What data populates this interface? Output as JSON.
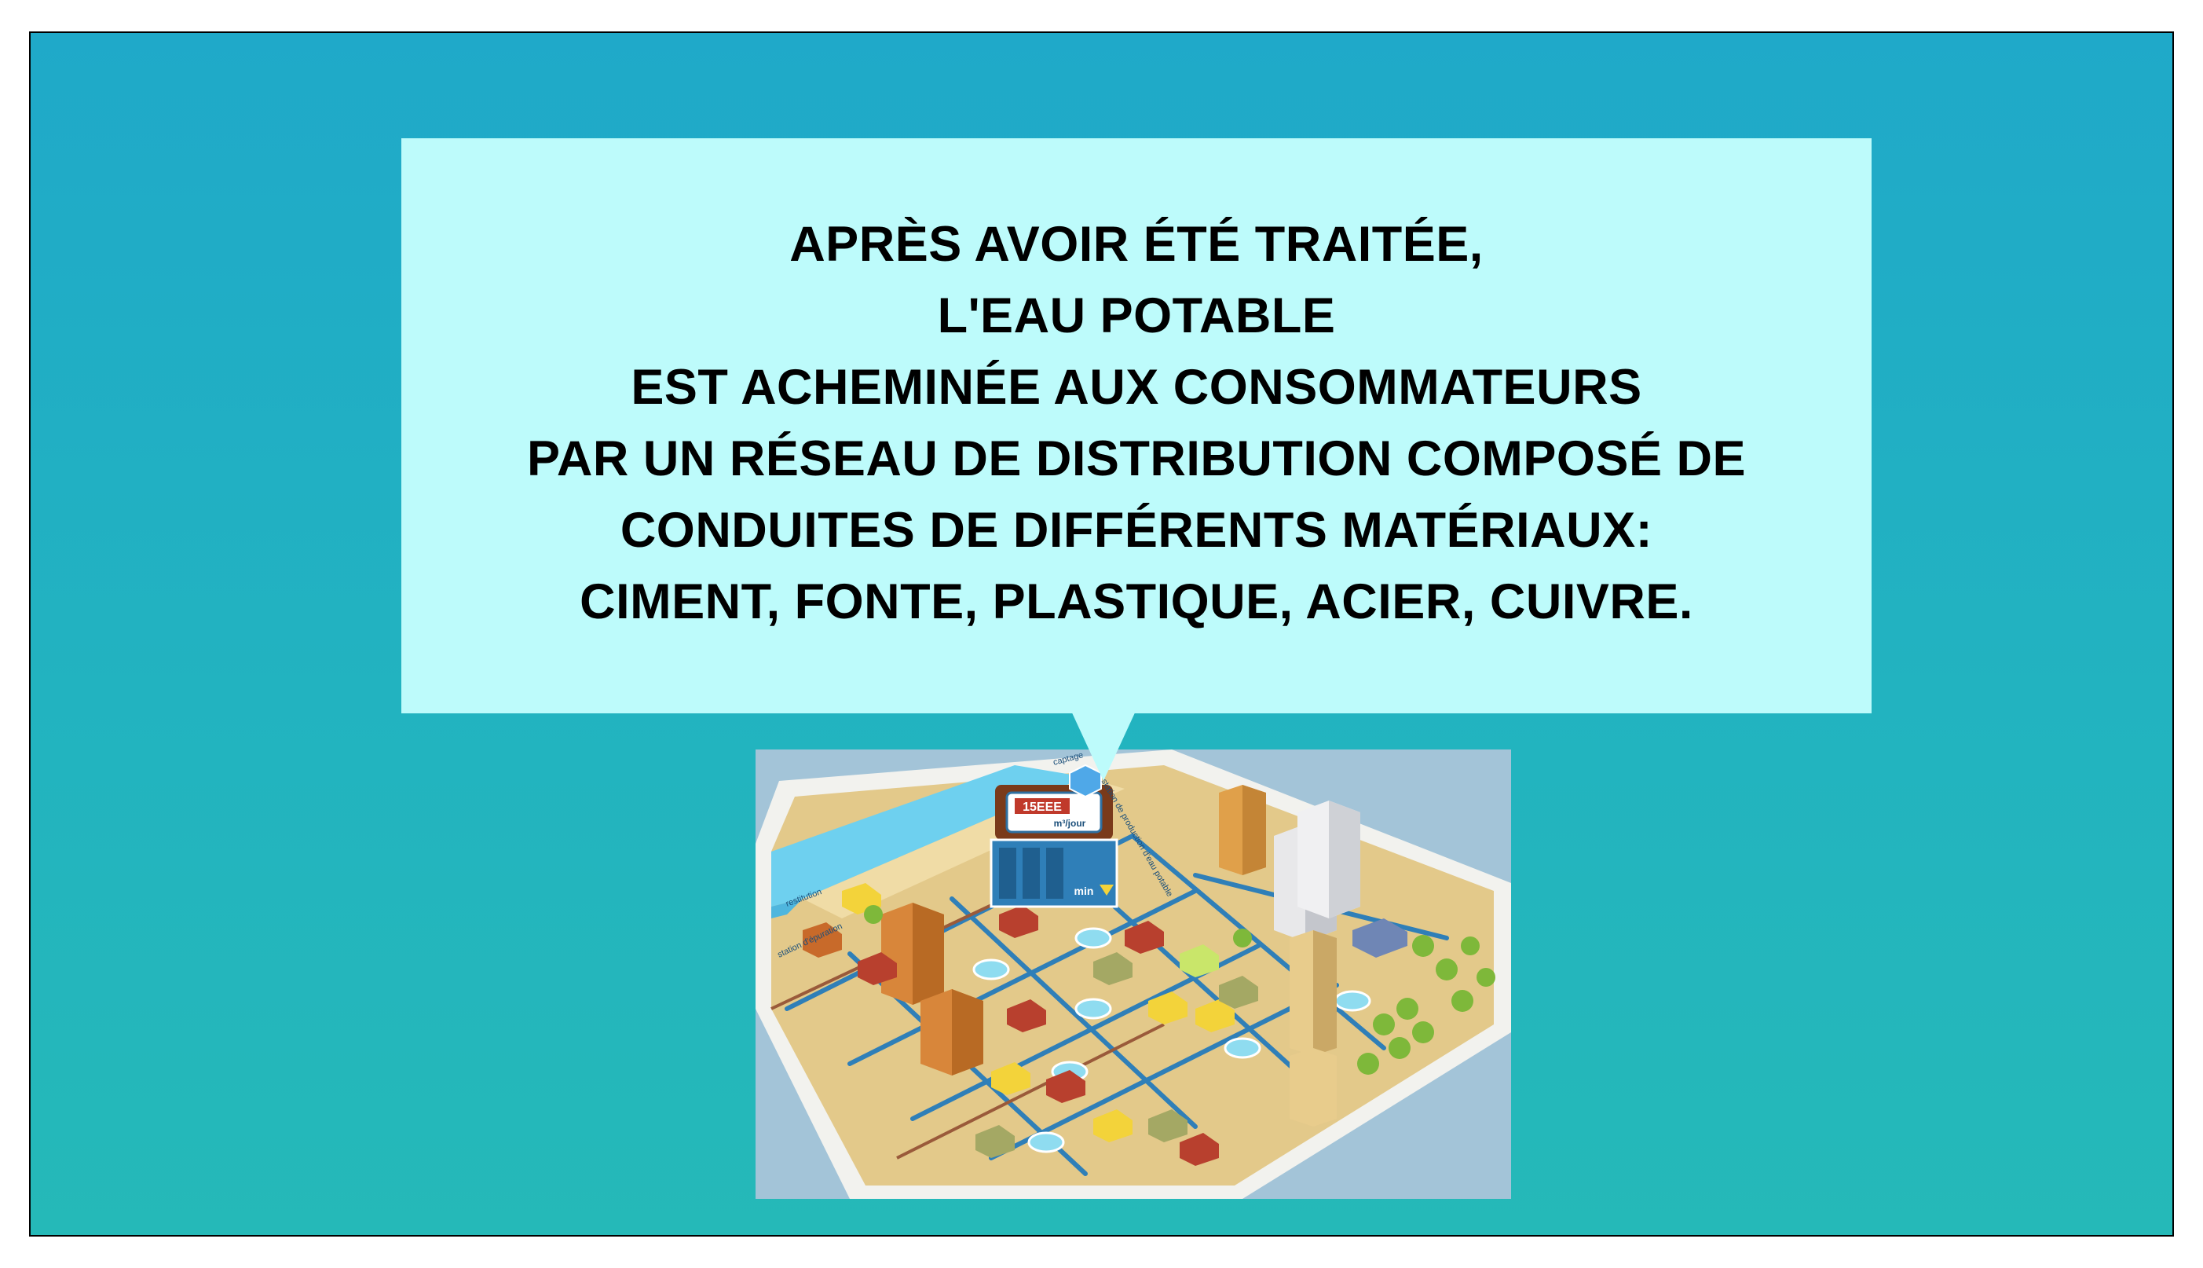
{
  "bubble": {
    "lines": [
      "APRÈS AVOIR ÉTÉ TRAITÉE,",
      "L'EAU POTABLE",
      "EST ACHEMINÉE AUX CONSOMMATEURS",
      "PAR UN RÉSEAU DE DISTRIBUTION COMPOSÉ DE",
      "CONDUITES DE DIFFÉRENTS MATÉRIAUX:",
      "CIMENT, FONTE, PLASTIQUE, ACIER, CUIVRE."
    ]
  },
  "illustration": {
    "meter_reading": "15EEE",
    "meter_unit": "m³/jour",
    "panel_label": "min",
    "label_restitution": "restitution",
    "label_station": "station de production d'eau potable",
    "label_captage": "captage",
    "label_station_epuration": "station d'épuration"
  },
  "colors": {
    "background_top": "#1fa9c9",
    "background_bottom": "#25b9b8",
    "bubble": "#bdfbfb",
    "text": "#000000"
  }
}
